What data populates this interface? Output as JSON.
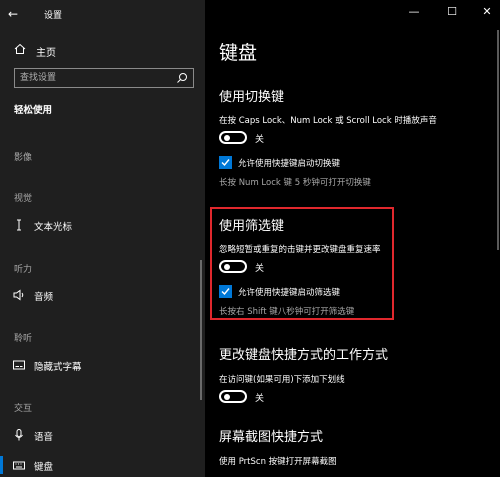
{
  "window": {
    "title": "设置",
    "controls": {
      "minimize": "—",
      "maximize": "☐",
      "close": "✕"
    }
  },
  "sidebar": {
    "home": "主页",
    "search_placeholder": "查找设置",
    "section": "轻松使用",
    "groups": {
      "vision_top": "影像",
      "vision": "视觉",
      "hearing": "听力",
      "listening": "聆听",
      "interaction": "交互"
    },
    "items": {
      "text_cursor": "文本光标",
      "audio": "音频",
      "captions": "隐藏式字幕",
      "speech": "语音",
      "keyboard": "键盘"
    }
  },
  "main": {
    "title": "键盘",
    "toggle_keys": {
      "heading": "使用切换键",
      "desc": "在按 Caps Lock、Num Lock 或 Scroll Lock 时播放声音",
      "state": "关",
      "checkbox_label": "允许使用快捷键启动切换键",
      "note": "长按 Num Lock 键 5 秒钟可打开切换键"
    },
    "filter_keys": {
      "heading": "使用筛选键",
      "desc": "忽略短暂或重复的击键并更改键盘重复速率",
      "state": "关",
      "checkbox_label": "允许使用快捷键启动筛选键",
      "note": "长按右 Shift 键八秒钟可打开筛选键"
    },
    "shortcuts": {
      "heading": "更改键盘快捷方式的工作方式",
      "desc": "在访问键(如果可用)下添加下划线",
      "state": "关"
    },
    "print_screen": {
      "heading": "屏幕截图快捷方式",
      "desc": "使用 PrtScn 按键打开屏幕截图"
    }
  },
  "colors": {
    "accent": "#0078d7",
    "highlight_border": "#e0282d",
    "sidebar_bg": "#1f1f1f",
    "main_bg": "#000000"
  }
}
